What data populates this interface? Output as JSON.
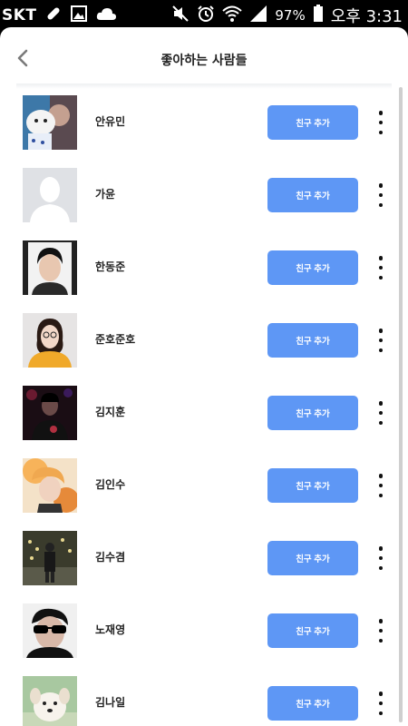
{
  "status_bar": {
    "carrier": "SKT",
    "battery": "97%",
    "time": "오후 3:31",
    "icons": [
      "bandage-icon",
      "image-icon",
      "cloud-icon",
      "mute-icon",
      "alarm-icon",
      "wifi-icon",
      "signal-icon",
      "battery-icon"
    ]
  },
  "header": {
    "title": "좋아하는 사람들",
    "back_icon": "chevron-left-icon"
  },
  "users": [
    {
      "name": "안유민",
      "button": "친구 추가"
    },
    {
      "name": "가윤",
      "button": "친구 추가"
    },
    {
      "name": "한동준",
      "button": "친구 추가"
    },
    {
      "name": "준호준호",
      "button": "친구 추가"
    },
    {
      "name": "김지훈",
      "button": "친구 추가"
    },
    {
      "name": "김인수",
      "button": "친구 추가"
    },
    {
      "name": "김수겸",
      "button": "친구 추가"
    },
    {
      "name": "노재영",
      "button": "친구 추가"
    },
    {
      "name": "김나일",
      "button": "친구 추가"
    }
  ],
  "colors": {
    "accent": "#5e97f5",
    "status_bar": "#000000",
    "background": "#ffffff"
  }
}
